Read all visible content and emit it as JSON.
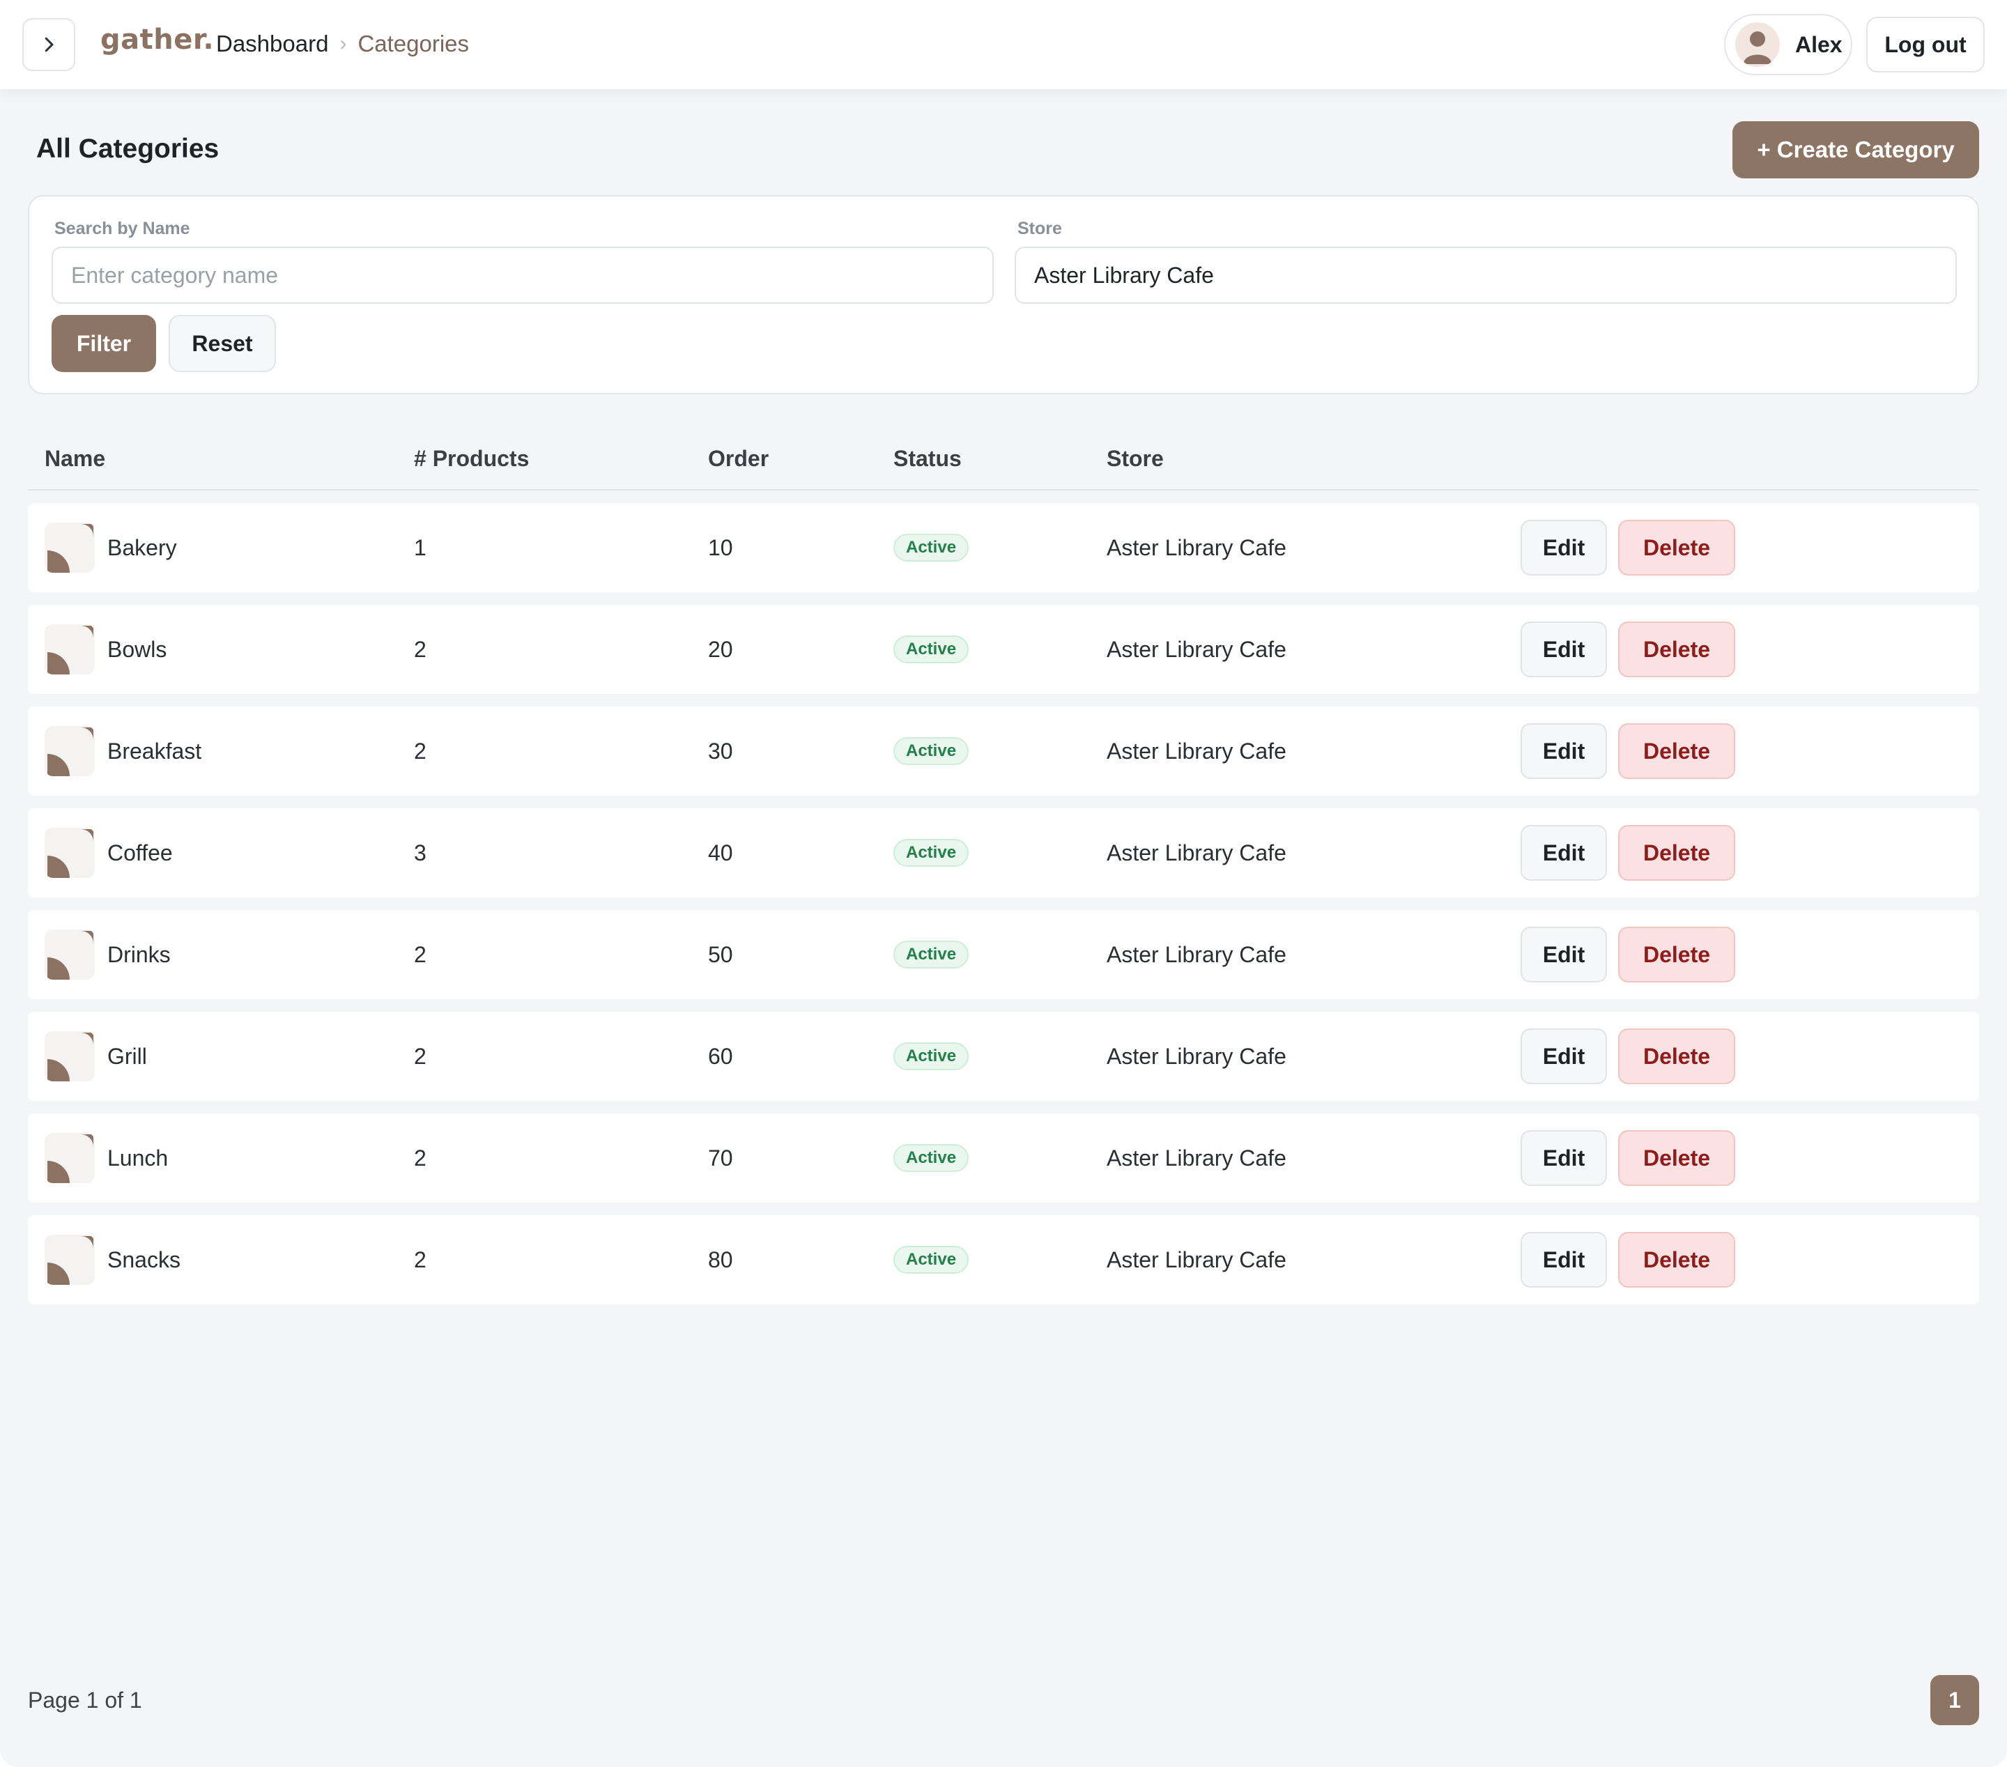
{
  "header": {
    "brand": "gather.",
    "breadcrumb": {
      "root": "Dashboard",
      "separator": "›",
      "current": "Categories"
    },
    "user": {
      "name": "Alex"
    },
    "logout_label": "Log out",
    "toggle_icon": "chevron-right-icon"
  },
  "page": {
    "title": "All Categories",
    "create_label": "+ Create Category"
  },
  "filters": {
    "search": {
      "label": "Search by Name",
      "placeholder": "Enter category name",
      "value": ""
    },
    "store": {
      "label": "Store",
      "value": "Aster Library Cafe"
    },
    "filter_label": "Filter",
    "reset_label": "Reset"
  },
  "table": {
    "columns": [
      "Name",
      "# Products",
      "Order",
      "Status",
      "Store"
    ],
    "rows": [
      {
        "name": "Bakery",
        "products": "1",
        "order": "10",
        "status": "Active",
        "store": "Aster Library Cafe",
        "edit": "Edit",
        "delete": "Delete"
      },
      {
        "name": "Bowls",
        "products": "2",
        "order": "20",
        "status": "Active",
        "store": "Aster Library Cafe",
        "edit": "Edit",
        "delete": "Delete"
      },
      {
        "name": "Breakfast",
        "products": "2",
        "order": "30",
        "status": "Active",
        "store": "Aster Library Cafe",
        "edit": "Edit",
        "delete": "Delete"
      },
      {
        "name": "Coffee",
        "products": "3",
        "order": "40",
        "status": "Active",
        "store": "Aster Library Cafe",
        "edit": "Edit",
        "delete": "Delete"
      },
      {
        "name": "Drinks",
        "products": "2",
        "order": "50",
        "status": "Active",
        "store": "Aster Library Cafe",
        "edit": "Edit",
        "delete": "Delete"
      },
      {
        "name": "Grill",
        "products": "2",
        "order": "60",
        "status": "Active",
        "store": "Aster Library Cafe",
        "edit": "Edit",
        "delete": "Delete"
      },
      {
        "name": "Lunch",
        "products": "2",
        "order": "70",
        "status": "Active",
        "store": "Aster Library Cafe",
        "edit": "Edit",
        "delete": "Delete"
      },
      {
        "name": "Snacks",
        "products": "2",
        "order": "80",
        "status": "Active",
        "store": "Aster Library Cafe",
        "edit": "Edit",
        "delete": "Delete"
      }
    ]
  },
  "pagination": {
    "info": "Page 1 of 1",
    "current": "1"
  },
  "colors": {
    "brand": "#8d7566",
    "background": "#f4f5f7",
    "active_badge": "#23804a",
    "delete_text": "#8e1c1c"
  }
}
